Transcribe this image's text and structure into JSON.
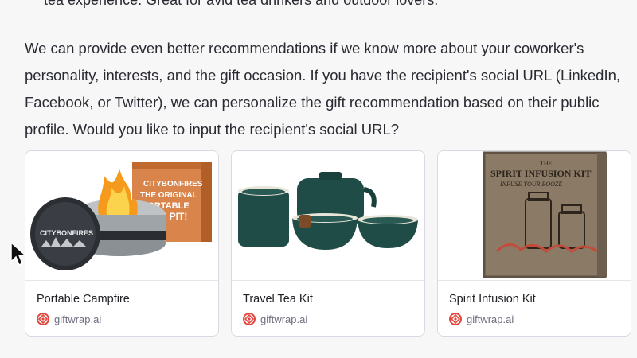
{
  "message": {
    "top_line": "tea experience. Great for avid tea drinkers and outdoor lovers.",
    "paragraph_lines": [
      "We can provide even better recommendations if we know more about your coworker's",
      "personality, interests, and the gift occasion. If you have the recipient's social URL (LinkedIn,",
      "Facebook, or Twitter), we can personalize the gift recommendation based on their public",
      "profile. Would you like to input the recipient's social URL?"
    ]
  },
  "cards": [
    {
      "title": "Portable Campfire",
      "source": "giftwrap.ai",
      "icon": "campfire-product-image",
      "box_lines": [
        "CITYBONFIRES",
        "THE ORIGINAL",
        "PORTABLE",
        "FIRE PIT!"
      ],
      "tin_label": "CITYBONFIRES"
    },
    {
      "title": "Travel Tea Kit",
      "source": "giftwrap.ai",
      "icon": "tea-kit-product-image"
    },
    {
      "title": "Spirit Infusion Kit",
      "source": "giftwrap.ai",
      "icon": "spirit-kit-product-image",
      "box_lines": [
        "THE",
        "SPIRIT INFUSION KIT",
        "INFUSE YOUR BOOZE"
      ]
    }
  ],
  "colors": {
    "logo": "#e1473d",
    "card_border": "#d9d9e3",
    "tea_green": "#1f4c46"
  }
}
